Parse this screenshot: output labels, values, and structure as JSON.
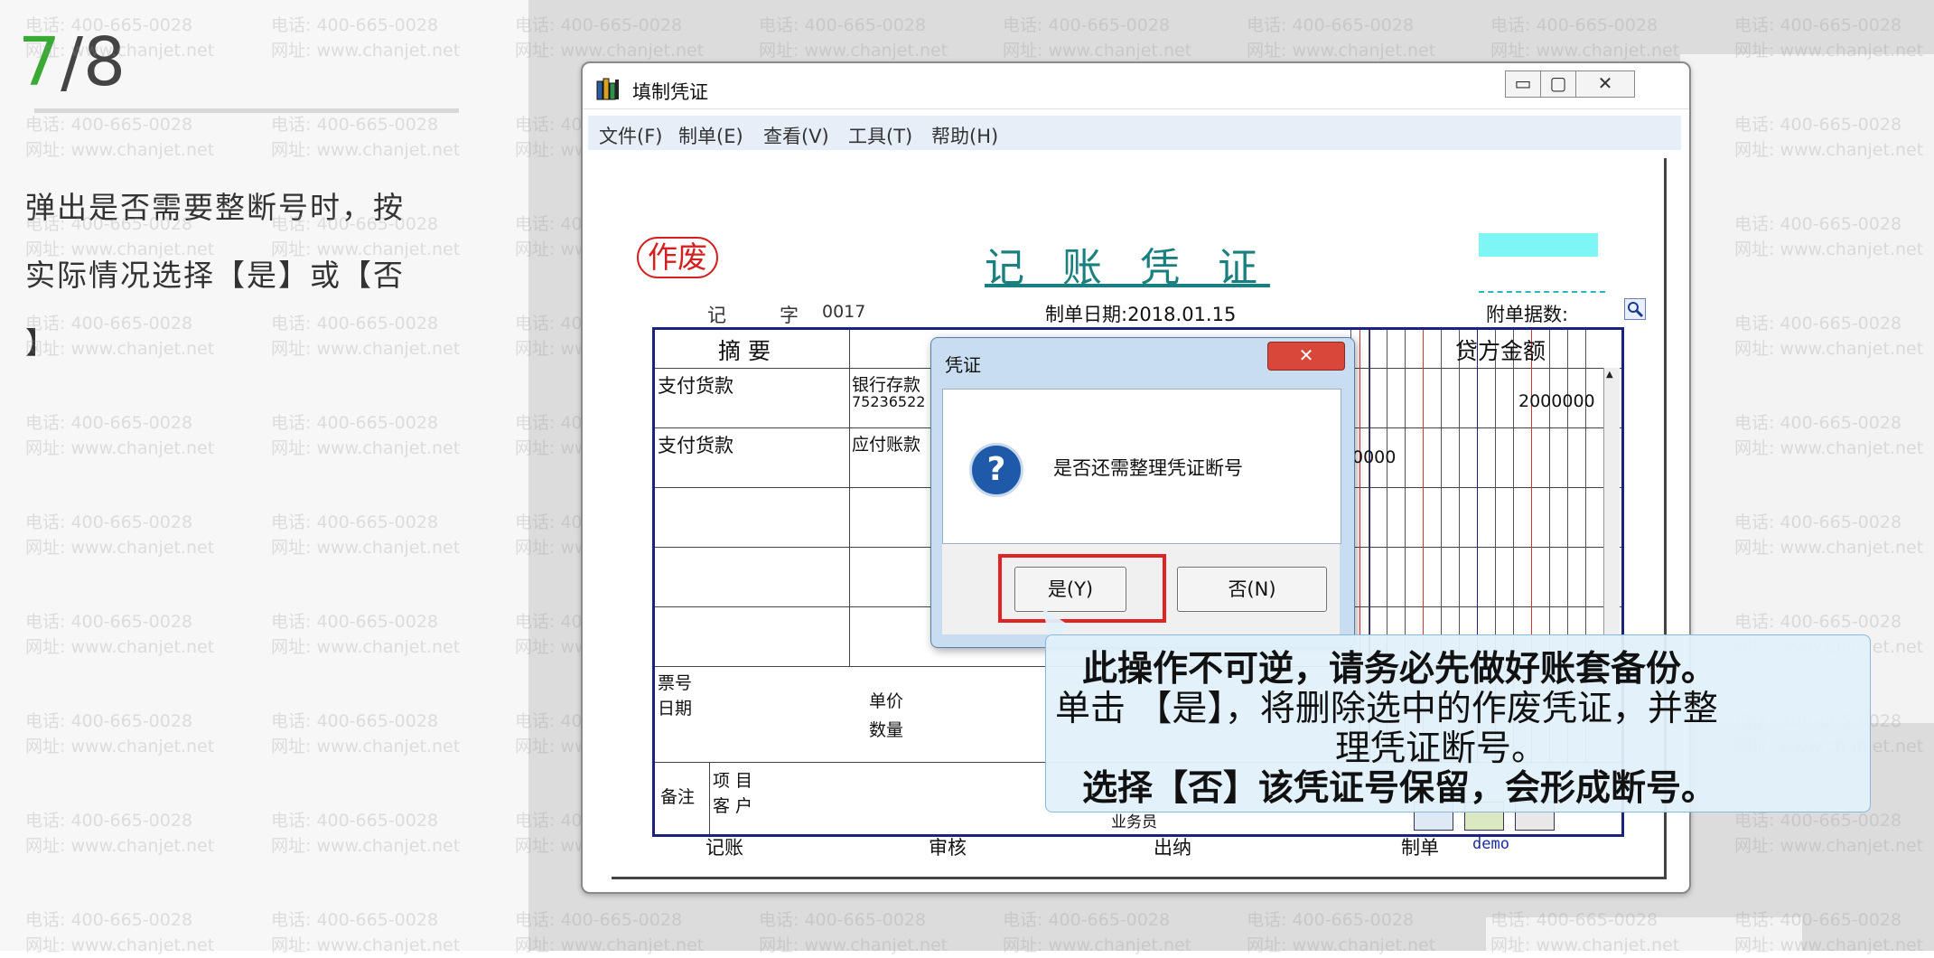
{
  "step": {
    "current": "7",
    "total": "/8"
  },
  "instruction": {
    "lines": [
      "弹出是否需要整断号时，按",
      "实际情况选择【是】或【否",
      "】"
    ]
  },
  "watermark": {
    "phone": "电话: 400-665-0028",
    "site": "网址: www.chanjet.net"
  },
  "window": {
    "title": "填制凭证",
    "buttons": {
      "minimize": "▭",
      "restore": "▢",
      "close": "✕"
    },
    "menu": [
      "文件(F)",
      "制单(E)",
      "查看(V)",
      "工具(T)",
      "帮助(H)"
    ]
  },
  "voucher": {
    "void_stamp": "作废",
    "title": "记 账 凭 证",
    "type_label": "记",
    "zi_label": "字",
    "number": "0017",
    "date_label": "制单日期:2018.01.15",
    "attachments_label": "附单据数:",
    "headers": {
      "summary": "摘 要",
      "credit": "贷方金额"
    },
    "rows": [
      {
        "summary": "支付货款",
        "account": "银行存款",
        "account_sub": "75236522",
        "credit": "2000000"
      },
      {
        "summary": "支付货款",
        "account": "应付账款",
        "debit_partial": "0000"
      }
    ],
    "footer": {
      "ticket_no": "票号",
      "date": "日期",
      "unit_price": "单价",
      "quantity": "数量",
      "remark": "备注",
      "project": "项  目",
      "customer": "客  户",
      "salesperson": "业务员",
      "bookkeeping": "记账",
      "review": "审核",
      "cashier": "出纳",
      "preparer": "制单",
      "preparer_name": "demo"
    }
  },
  "dialog": {
    "title": "凭证",
    "close": "✕",
    "message": "是否还需整理凭证断号",
    "icon": "question-icon",
    "yes": "是(Y)",
    "no": "否(N)"
  },
  "callout": {
    "lines": [
      "此操作不可逆，请务必先做好账套备份。",
      "单击 【是】，将删除选中的作废凭证，并整",
      "理凭证断号。",
      "选择【否】该凭证号保留，会形成断号。"
    ]
  },
  "colors": {
    "step_accent": "#3aaa35",
    "void_red": "#d42020",
    "title_teal": "#1a7f7f",
    "grid_navy": "#1a237e",
    "highlight_red": "#e02424"
  }
}
